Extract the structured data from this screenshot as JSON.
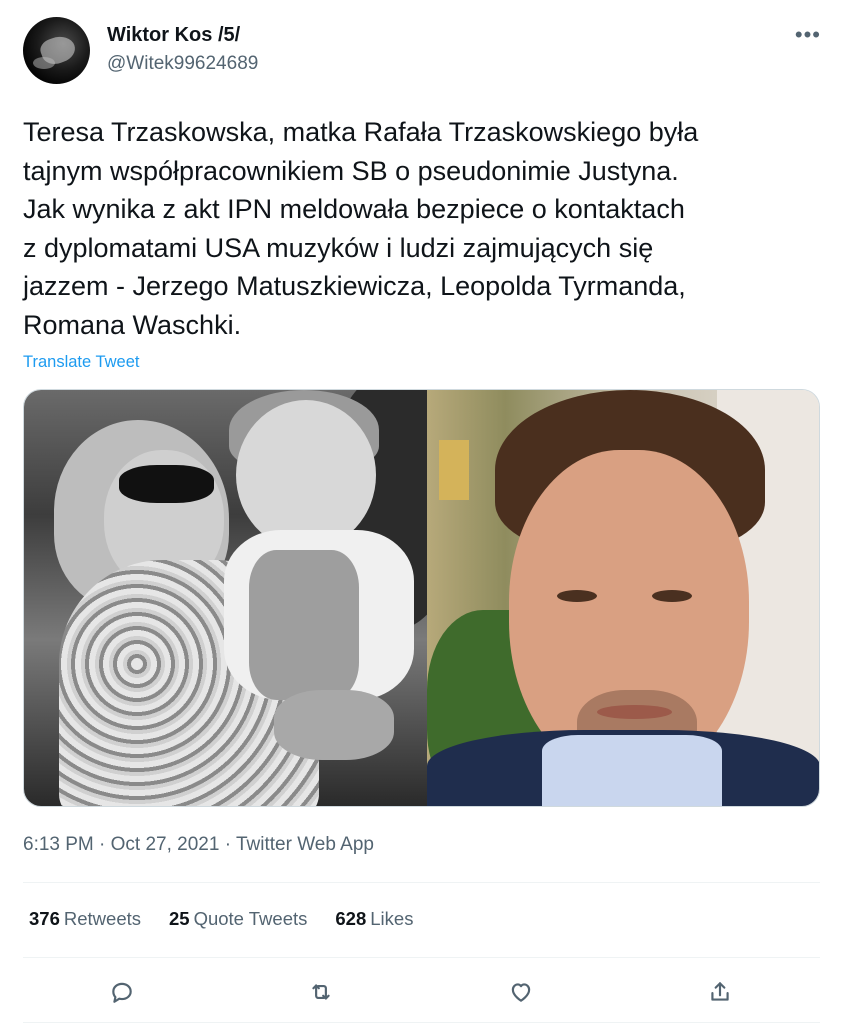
{
  "author": {
    "display_name": "Wiktor Kos /5/",
    "handle": "@Witek99624689"
  },
  "more_icon": "more-horizontal-icon",
  "tweet": {
    "text": "Teresa Trzaskowska, matka Rafała Trzaskowskiego była\ntajnym współpracownikiem SB o pseudonimie Justyna.\nJak wynika z akt IPN meldowała bezpiece o kontaktach\nz dyplomatami USA muzyków i ludzi zajmujących się\njazzem - Jerzego Matuszkiewicza, Leopolda Tyrmanda,\nRomana Waschki.",
    "translate_label": "Translate Tweet"
  },
  "meta": {
    "timestamp": "6:13 PM · Oct 27, 2021 · Twitter Web App"
  },
  "stats": {
    "retweets_count": "376",
    "retweets_label": "Retweets",
    "quotes_count": "25",
    "quotes_label": "Quote Tweets",
    "likes_count": "628",
    "likes_label": "Likes"
  },
  "actions": {
    "icons": [
      "reply-icon",
      "retweet-icon",
      "like-icon",
      "share-icon"
    ]
  },
  "colors": {
    "text": "#0f1419",
    "secondary": "#536471",
    "link": "#1d9bf0",
    "border": "#cfd9de"
  }
}
